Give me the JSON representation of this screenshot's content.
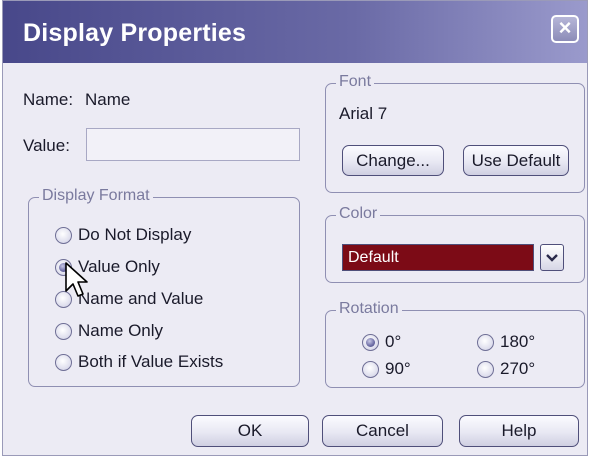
{
  "window": {
    "title": "Display Properties",
    "close_icon": "×"
  },
  "name_field": {
    "label": "Name:",
    "value": "Name"
  },
  "value_field": {
    "label": "Value:",
    "value": ""
  },
  "display_format": {
    "legend": "Display Format",
    "options": [
      "Do Not Display",
      "Value Only",
      "Name and Value",
      "Name Only",
      "Both if Value Exists"
    ],
    "selected": "Value Only"
  },
  "font_group": {
    "legend": "Font",
    "current_font": "Arial 7",
    "change_label": "Change...",
    "use_default_label": "Use Default"
  },
  "color_group": {
    "legend": "Color",
    "selected": "Default",
    "swatch": "#7c0b16"
  },
  "rotation_group": {
    "legend": "Rotation",
    "options": [
      "0°",
      "180°",
      "90°",
      "270°"
    ],
    "selected": "0°"
  },
  "buttons": {
    "ok": "OK",
    "cancel": "Cancel",
    "help": "Help"
  }
}
